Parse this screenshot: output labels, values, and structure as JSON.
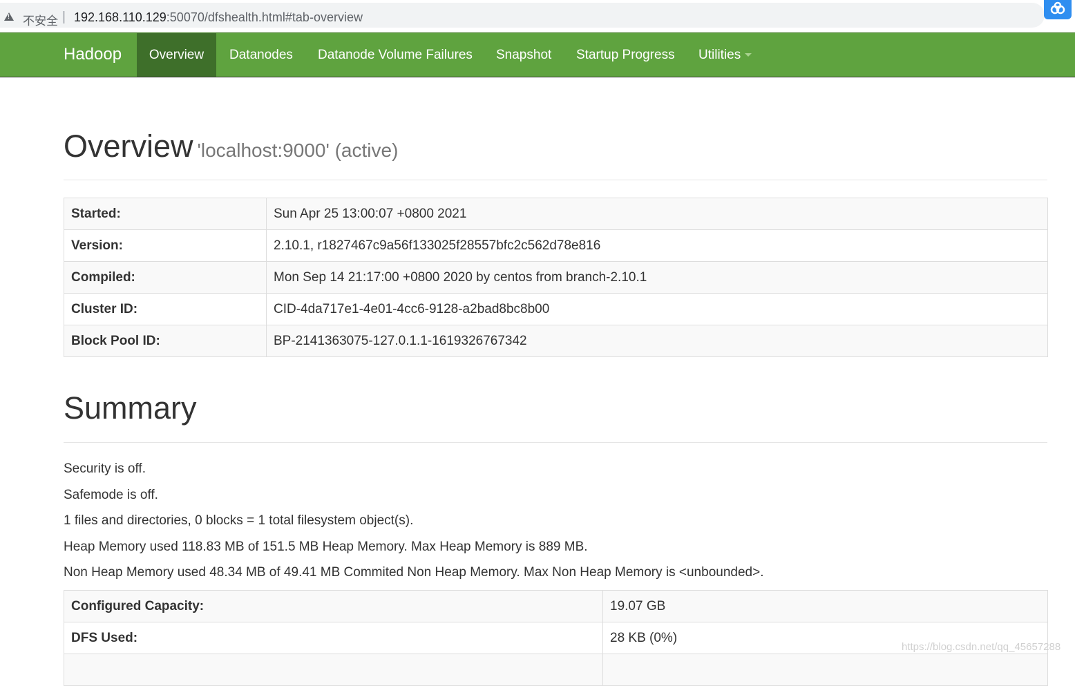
{
  "browser": {
    "insecure_label": "不安全",
    "separator": "|",
    "url_host": "192.168.110.129",
    "url_rest": ":50070/dfshealth.html#tab-overview"
  },
  "navbar": {
    "brand": "Hadoop",
    "items": [
      {
        "label": "Overview",
        "active": true
      },
      {
        "label": "Datanodes"
      },
      {
        "label": "Datanode Volume Failures"
      },
      {
        "label": "Snapshot"
      },
      {
        "label": "Startup Progress"
      },
      {
        "label": "Utilities"
      }
    ]
  },
  "overview": {
    "title": "Overview",
    "subtitle": "'localhost:9000' (active)",
    "rows": [
      {
        "label": "Started:",
        "value": "Sun Apr 25 13:00:07 +0800 2021"
      },
      {
        "label": "Version:",
        "value": "2.10.1, r1827467c9a56f133025f28557bfc2c562d78e816"
      },
      {
        "label": "Compiled:",
        "value": "Mon Sep 14 21:17:00 +0800 2020 by centos from branch-2.10.1"
      },
      {
        "label": "Cluster ID:",
        "value": "CID-4da717e1-4e01-4cc6-9128-a2bad8bc8b00"
      },
      {
        "label": "Block Pool ID:",
        "value": "BP-2141363075-127.0.1.1-1619326767342"
      }
    ]
  },
  "summary": {
    "title": "Summary",
    "lines": [
      "Security is off.",
      "Safemode is off.",
      "1 files and directories, 0 blocks = 1 total filesystem object(s).",
      "Heap Memory used 118.83 MB of 151.5 MB Heap Memory. Max Heap Memory is 889 MB.",
      "Non Heap Memory used 48.34 MB of 49.41 MB Commited Non Heap Memory. Max Non Heap Memory is <unbounded>."
    ],
    "rows": [
      {
        "label": "Configured Capacity:",
        "value": "19.07 GB"
      },
      {
        "label": "DFS Used:",
        "value": "28 KB (0%)"
      },
      {
        "label": "",
        "value": ""
      }
    ]
  },
  "watermark": "https://blog.csdn.net/qq_45657288"
}
